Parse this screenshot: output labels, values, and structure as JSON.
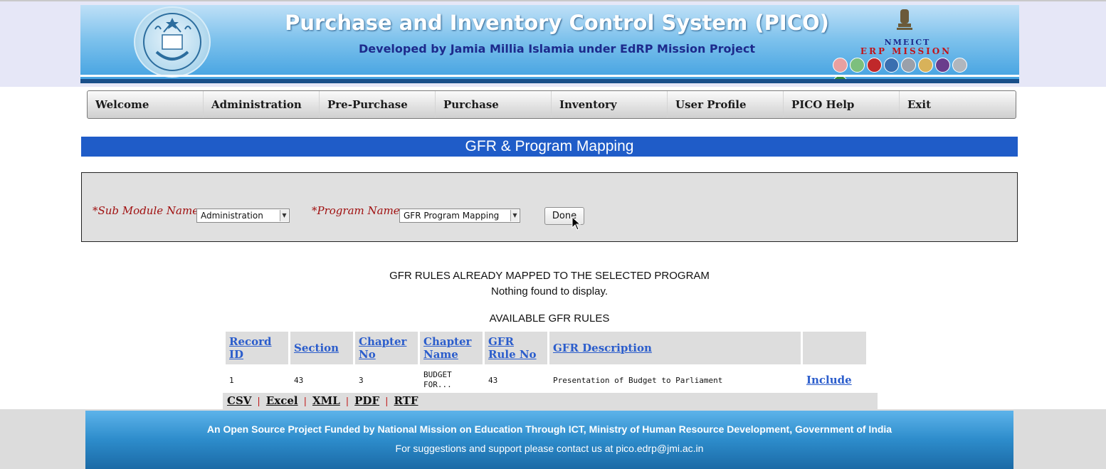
{
  "header": {
    "title": "Purchase and Inventory Control System (PICO)",
    "subtitle": "Developed by Jamia Millia Islamia under EdRP Mission Project",
    "right_logo_line1": "NMEICT",
    "right_logo_line2": "ERP MISSION"
  },
  "menu": {
    "items": [
      {
        "label": "Welcome"
      },
      {
        "label": "Administration"
      },
      {
        "label": "Pre-Purchase"
      },
      {
        "label": "Purchase"
      },
      {
        "label": "Inventory"
      },
      {
        "label": "User Profile"
      },
      {
        "label": "PICO Help"
      },
      {
        "label": "Exit"
      }
    ]
  },
  "page": {
    "title": "GFR & Program Mapping"
  },
  "form": {
    "sub_module_label": "*Sub Module Name:",
    "sub_module_value": "Administration",
    "program_label": "*Program Name:",
    "program_value": "GFR Program Mapping",
    "done_label": "Done"
  },
  "mapped": {
    "heading": "GFR RULES ALREADY MAPPED TO THE SELECTED PROGRAM",
    "empty_message": "Nothing found to display."
  },
  "available": {
    "heading": "AVAILABLE GFR RULES",
    "columns": [
      "Record ID",
      "Section",
      "Chapter No",
      "Chapter Name",
      "GFR Rule No",
      "GFR Description",
      ""
    ],
    "rows": [
      {
        "record_id": "1",
        "section": "43",
        "chapter_no": "3",
        "chapter_name": "BUDGET FOR...",
        "gfr_rule_no": "43",
        "gfr_description": "Presentation of Budget to Parliament",
        "action": "Include"
      }
    ]
  },
  "export": {
    "options": [
      "CSV",
      "Excel",
      "XML",
      "PDF",
      "RTF"
    ],
    "separator": "|"
  },
  "footer": {
    "line1": "An Open Source Project Funded by National Mission on Education Through ICT, Ministry of Human Resource Development, Government of India",
    "line2": "For suggestions and support please contact us at pico.edrp@jmi.ac.in"
  },
  "colors": {
    "title_bar": "#1f5cc8",
    "link": "#2b5dcc",
    "required_label": "#a01010"
  }
}
